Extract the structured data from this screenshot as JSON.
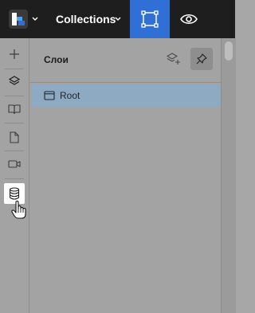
{
  "topbar": {
    "logo_icon": "brand-logo-icon",
    "collections_label": "Collections",
    "select_tool_icon": "bounding-box-icon",
    "preview_icon": "eye-icon"
  },
  "rail": {
    "items": [
      {
        "icon": "plus-icon"
      },
      {
        "icon": "layers-icon"
      },
      {
        "icon": "book-icon"
      },
      {
        "icon": "page-icon"
      },
      {
        "icon": "video-icon"
      },
      {
        "icon": "database-icon",
        "active": true
      }
    ]
  },
  "panel": {
    "title": "Слои",
    "add_layer_icon": "layers-add-icon",
    "pin_icon": "pin-icon",
    "tree": [
      {
        "label": "Root",
        "icon": "window-icon",
        "selected": true
      }
    ]
  },
  "colors": {
    "topbar_bg": "#1e1e1e",
    "accent": "#2f6fd6",
    "selection": "#8eaac2"
  }
}
